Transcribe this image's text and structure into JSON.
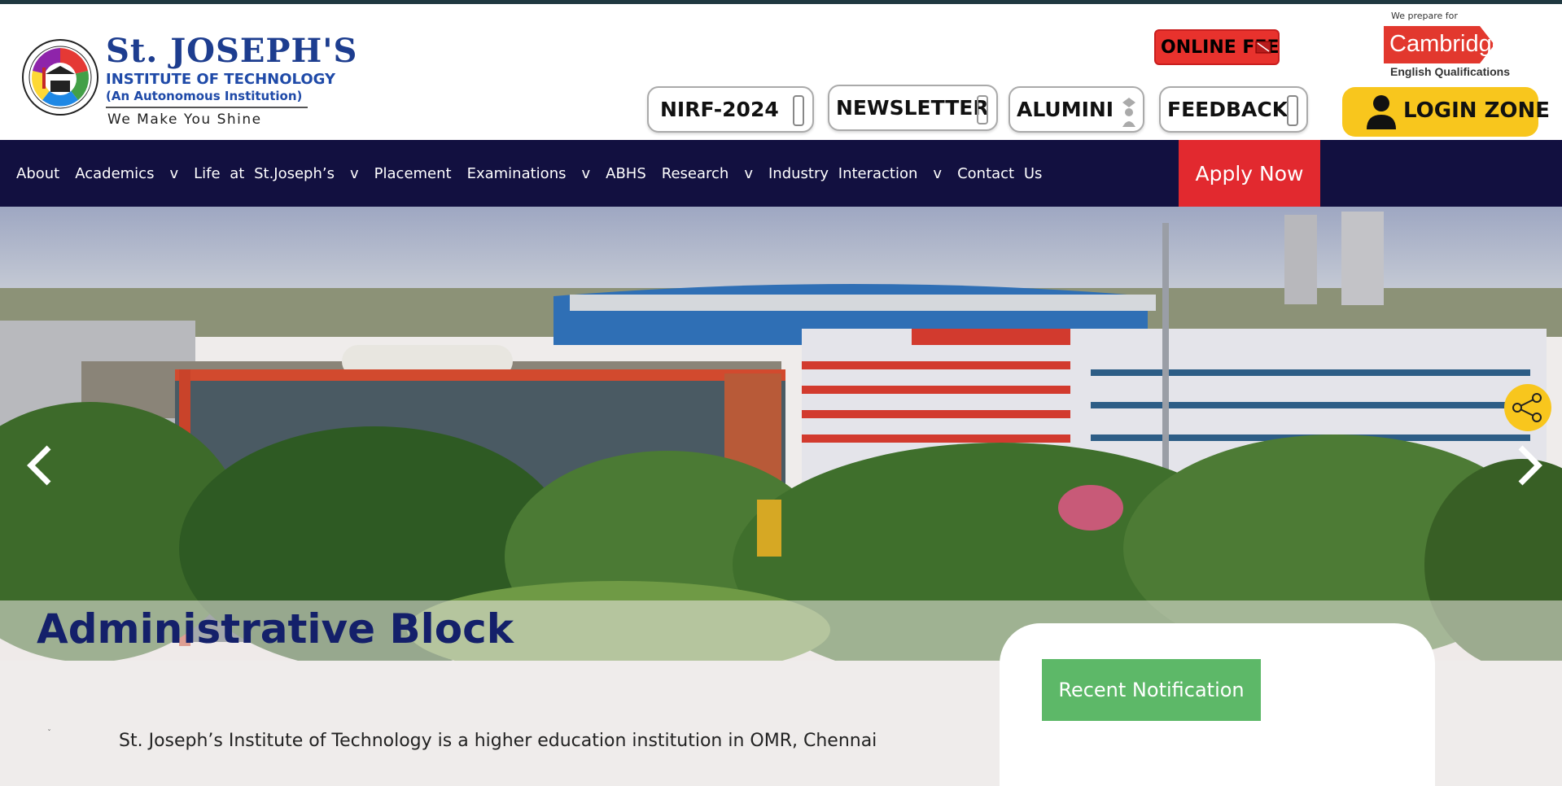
{
  "logo": {
    "name": "St. JOSEPH'S",
    "line2": "INSTITUTE OF TECHNOLOGY",
    "line3": "(An Autonomous Institution)",
    "tagline": "We Make You Shine"
  },
  "quick_links": {
    "online_fee": "ONLINE FEE",
    "nirf": "NIRF-2024",
    "newsletter": "NEWSLETTER",
    "alumni": "ALUMINI",
    "feedback": "FEEDBACK",
    "login": "LOGIN ZONE"
  },
  "cambridge": {
    "prefix": "We prepare for",
    "name": "Cambridge",
    "sub": "English Qualifications"
  },
  "nav": {
    "items": [
      {
        "label": "About",
        "chevron": ""
      },
      {
        "label": "Academics",
        "chevron": "v"
      },
      {
        "label": "Life at St.Joseph’s",
        "chevron": "v"
      },
      {
        "label": "Placement",
        "chevron": ""
      },
      {
        "label": "Examinations",
        "chevron": "v"
      },
      {
        "label": "ABHS",
        "chevron": ""
      },
      {
        "label": "Research",
        "chevron": "v"
      },
      {
        "label": "Industry Interaction",
        "chevron": "v"
      },
      {
        "label": "Contact Us",
        "chevron": ""
      }
    ],
    "apply": "Apply Now"
  },
  "hero": {
    "caption": "Administrative Block",
    "prev_icon": "chevron-left-icon",
    "next_icon": "chevron-right-icon",
    "share_icon": "share-icon"
  },
  "notifications": {
    "button": "Recent Notification"
  },
  "intro_text": "St. Joseph’s Institute of Technology is a higher education institution in OMR, Chennai",
  "colors": {
    "nav_bg": "#121040",
    "apply_bg": "#e2292f",
    "login_bg": "#f8c61d",
    "recent_bg": "#5db868",
    "caption_text": "#14206a"
  }
}
